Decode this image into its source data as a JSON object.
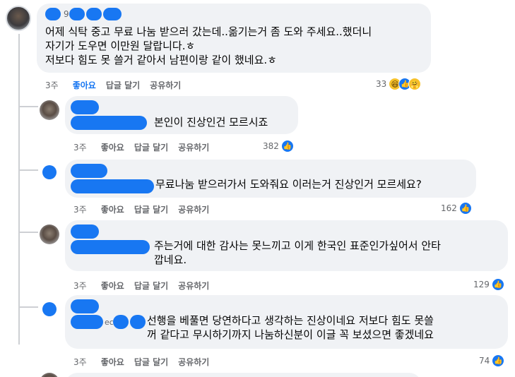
{
  "main_comment": {
    "name_suffix": "9",
    "text": "어제 식탁 중고 무료 나눔 받으러 갔는데..옮기는거 좀 도와 주세요..했더니\n자기가 도우면 이만원 달랍니다.ㅎ\n저보다 힘도 못 쓸거 같아서 남편이랑 같이 했네요.ㅎ",
    "time": "3주",
    "like_label": "좋아요",
    "reply_label": "답글 달기",
    "share_label": "공유하기",
    "reaction_count": "33",
    "reaction_icons": [
      "haha-icon",
      "like-icon",
      "care-icon"
    ]
  },
  "replies": [
    {
      "text": "본인이 진상인건 모르시죠",
      "time": "3주",
      "like_label": "좋아요",
      "reply_label": "답글 달기",
      "share_label": "공유하기",
      "reaction_count": "382"
    },
    {
      "text": "무료나눔 받으러가서 도와줘요 이러는거 진상인거 모르세요?",
      "time": "3주",
      "like_label": "좋아요",
      "reply_label": "답글 달기",
      "share_label": "공유하기",
      "reaction_count": "162"
    },
    {
      "text": "주는거에 대한 감사는 못느끼고 이게 한국인 표준인가싶어서 안타\n깝네요.",
      "time": "3주",
      "like_label": "좋아요",
      "reply_label": "답글 달기",
      "share_label": "공유하기",
      "reaction_count": "129"
    },
    {
      "name_fragment": "ec",
      "text": "선행을 베풀면 당연하다고 생각하는 진상이네요 저보다 힘도 못쓸\n꺼 같다고 무시하기까지 나눔하신분이 이글 꼭 보셨으면 좋겠네요",
      "time": "3주",
      "like_label": "좋아요",
      "reply_label": "답글 달기",
      "share_label": "공유하기",
      "reaction_count": "74"
    }
  ],
  "colors": {
    "accent": "#1877f2",
    "bubble": "#f0f2f5",
    "meta": "#65676b"
  }
}
